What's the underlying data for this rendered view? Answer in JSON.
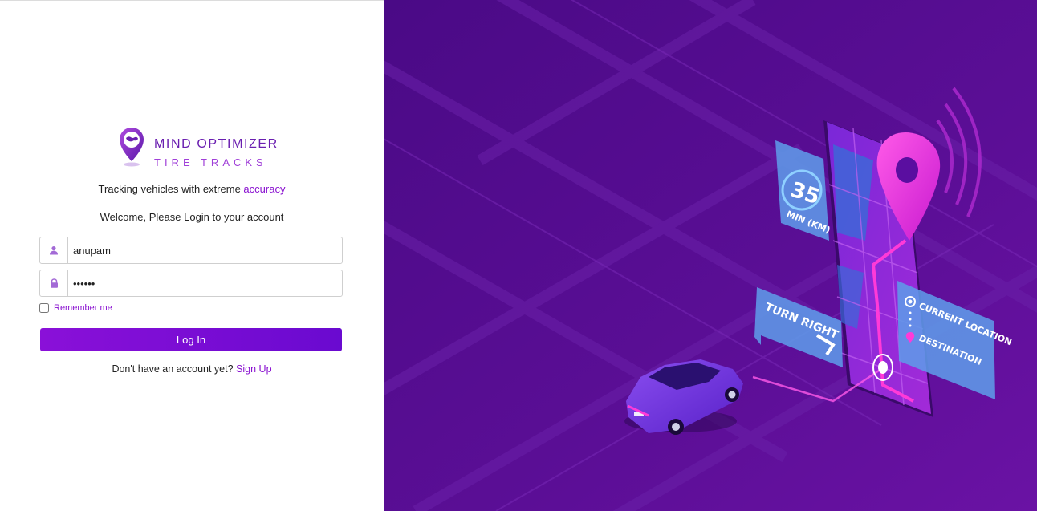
{
  "brand": {
    "line1": "MIND OPTIMIZER",
    "line2": "TIRE TRACKS"
  },
  "tagline": {
    "prefix": "Tracking vehicles with extreme",
    "accent": "accuracy"
  },
  "welcome": "Welcome, Please Login to your account",
  "form": {
    "username_value": "anupam",
    "password_value": "••••••",
    "remember_label": "Remember me",
    "login_label": "Log In"
  },
  "signup": {
    "prompt": "Don't have an account yet?",
    "link": "Sign Up"
  },
  "illustration": {
    "speed_value": "35",
    "speed_unit": "MIN (KM)",
    "turn_label": "TURN RIGHT",
    "current_location_label": "CURRENT LOCATION",
    "destination_label": "DESTINATION"
  },
  "colors": {
    "accent": "#8a12d0",
    "panel_bg": "#4d0a86",
    "pin": "#e22ad6"
  }
}
